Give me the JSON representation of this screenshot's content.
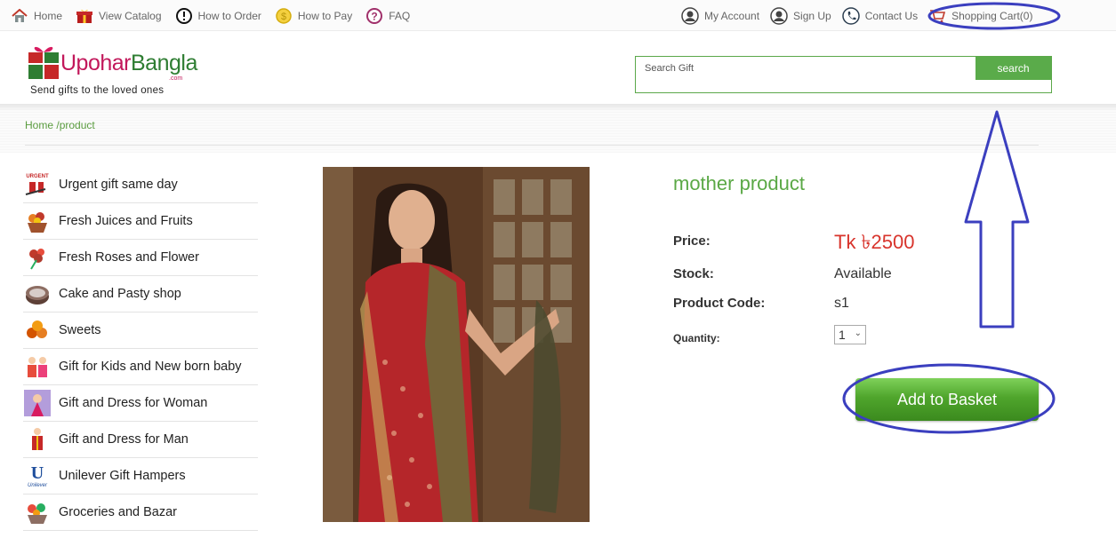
{
  "topnav": {
    "left": [
      {
        "label": "Home",
        "icon": "home-icon"
      },
      {
        "label": "View Catalog",
        "icon": "gift-box-icon"
      },
      {
        "label": "How to Order",
        "icon": "info-icon"
      },
      {
        "label": "How to Pay",
        "icon": "coin-icon"
      },
      {
        "label": "FAQ",
        "icon": "question-icon"
      }
    ],
    "right": [
      {
        "label": "My Account",
        "icon": "user-icon"
      },
      {
        "label": "Sign Up",
        "icon": "user-icon"
      },
      {
        "label": "Contact Us",
        "icon": "phone-icon"
      },
      {
        "label": "Shopping Cart(0)",
        "icon": "cart-icon"
      }
    ]
  },
  "logo": {
    "name_part1": "Upohar",
    "name_part2": "Bangla",
    "domain": ".com",
    "tagline": "Send gifts to the loved ones"
  },
  "search": {
    "placeholder": "Search Gift",
    "button_label": "search"
  },
  "breadcrumb": {
    "home": "Home",
    "current": "/product"
  },
  "categories": [
    {
      "label": "Urgent gift same day",
      "icon": "urgent-gift-icon"
    },
    {
      "label": "Fresh Juices and Fruits",
      "icon": "fruit-basket-icon"
    },
    {
      "label": "Fresh Roses and Flower",
      "icon": "rose-icon"
    },
    {
      "label": "Cake and Pasty shop",
      "icon": "cake-icon"
    },
    {
      "label": "Sweets",
      "icon": "sweets-icon"
    },
    {
      "label": "Gift for Kids and New born baby",
      "icon": "kids-icon"
    },
    {
      "label": "Gift and Dress for Woman",
      "icon": "woman-dress-icon"
    },
    {
      "label": "Gift and Dress for Man",
      "icon": "man-dress-icon"
    },
    {
      "label": "Unilever Gift Hampers",
      "icon": "unilever-icon"
    },
    {
      "label": "Groceries and Bazar",
      "icon": "groceries-icon"
    }
  ],
  "urgent_badge": "URGENT",
  "unilever_text": "Unilever",
  "product": {
    "title": "mother product",
    "price_label": "Price:",
    "price": "Tk ৳2500",
    "stock_label": "Stock:",
    "stock": "Available",
    "code_label": "Product Code:",
    "code": "s1",
    "quantity_label": "Quantity:",
    "quantity": "1",
    "add_button": "Add to Basket"
  },
  "colors": {
    "brand_green": "#5aa845",
    "price_red": "#d8342c",
    "annotation_blue": "#3b3fbf"
  }
}
